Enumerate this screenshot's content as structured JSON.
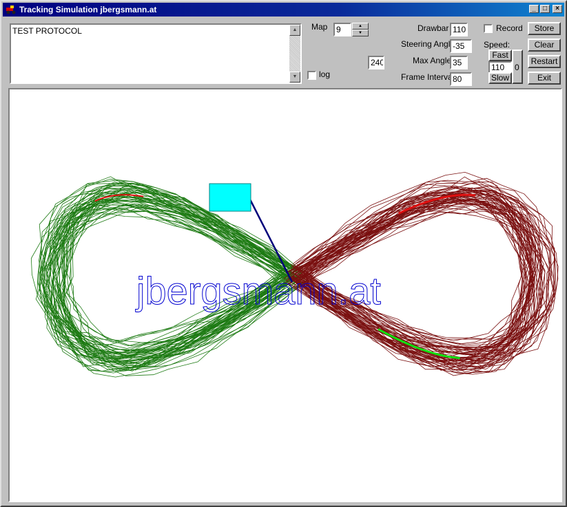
{
  "window": {
    "title": "Tracking Simulation jbergsmann.at"
  },
  "protocol": {
    "text": "TEST PROTOCOL"
  },
  "map": {
    "label": "Map",
    "value": "9"
  },
  "counter": {
    "value": "240"
  },
  "log": {
    "label": "log",
    "checked": false
  },
  "params": {
    "drawbar": {
      "label": "Drawbar",
      "value": "110"
    },
    "steering_angle": {
      "label": "Steering Angle",
      "value": "-35"
    },
    "max_angle": {
      "label": "Max Angle",
      "value": "35"
    },
    "frame_interval": {
      "label": "Frame Interval",
      "value": "80"
    }
  },
  "record": {
    "label": "Record",
    "checked": false
  },
  "speed": {
    "label": "Speed:",
    "fast_label": "Fast",
    "value": "110",
    "slow_label": "Slow",
    "scale_value": "0"
  },
  "buttons": {
    "store": "Store",
    "clear": "Clear",
    "restart": "Restart",
    "exit": "Exit"
  },
  "canvas": {
    "watermark": "jbergsmann.at"
  },
  "colors": {
    "left_loop": "#1c7a12",
    "right_loop": "#7a1010",
    "highlight_red": "#e01010",
    "highlight_green": "#10e010",
    "vehicle": "#00ffff",
    "drawbar_line": "#00007a",
    "watermark": "#0000d0"
  },
  "icons": {
    "app": "tractor-icon",
    "minimize": "minimize-icon",
    "maximize": "maximize-icon",
    "close": "close-icon"
  }
}
